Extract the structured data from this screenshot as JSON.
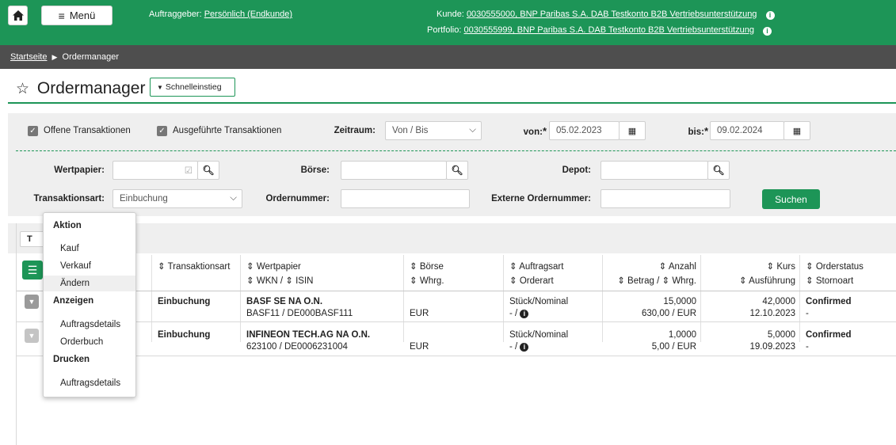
{
  "header": {
    "menu_label": "Menü",
    "client_prefix": "Auftraggeber:",
    "client_value": "Persönlich (Endkunde)",
    "customer_prefix": "Kunde:",
    "customer_value": "0030555000, BNP Paribas S.A. DAB Testkonto B2B Vertriebsunterstützung",
    "portfolio_prefix": "Portfolio:",
    "portfolio_value": "0030555999, BNP Paribas S.A. DAB Testkonto B2B Vertriebsunterstützung",
    "info_glyph": "i"
  },
  "breadcrumb": {
    "home": "Startseite",
    "current": "Ordermanager"
  },
  "page": {
    "title": "Ordermanager",
    "quick_entry": "Schnelleinstieg"
  },
  "filters": {
    "open_tx": "Offene Transaktionen",
    "executed_tx": "Ausgeführte Transaktionen",
    "period_label": "Zeitraum:",
    "period_value": "Von / Bis",
    "from_label": "von:",
    "from_value": "05.02.2023",
    "to_label": "bis:",
    "to_value": "09.02.2024",
    "required_mark": "*",
    "security_label": "Wertpapier:",
    "security_value": "",
    "exchange_label": "Börse:",
    "exchange_value": "",
    "depot_label": "Depot:",
    "depot_value": "",
    "tx_type_label": "Transaktionsart:",
    "tx_type_value": "Einbuchung",
    "order_no_label": "Ordernummer:",
    "order_no_value": "",
    "ext_order_no_label": "Externe Ordernummer:",
    "ext_order_no_value": "",
    "search_button": "Suchen",
    "filter_button": "T"
  },
  "table": {
    "headers": {
      "tx_type": "Transaktionsart",
      "security": "Wertpapier",
      "wkn_isin": "WKN / ⇕ ISIN",
      "exchange": "Börse",
      "currency": "Whrg.",
      "order_type": "Auftragsart",
      "order_kind": "Orderart",
      "quantity": "Anzahl",
      "amount_currency": "Betrag / ⇕ Whrg.",
      "price": "Kurs",
      "execution": "Ausführung",
      "order_status": "Orderstatus",
      "cancel_type": "Stornoart"
    },
    "rows": [
      {
        "tx_type": "Einbuchung",
        "security": "BASF SE NA O.N.",
        "wkn_isin": "BASF11 / DE000BASF111",
        "currency": "EUR",
        "order_type": "Stück/Nominal",
        "order_kind": "- /",
        "quantity": "15,0000",
        "amount": "630,00 / EUR",
        "price": "42,0000",
        "execution": "12.10.2023",
        "order_status": "Confirmed",
        "cancel_type": "-"
      },
      {
        "tx_type": "Einbuchung",
        "security": "INFINEON TECH.AG NA O.N.",
        "wkn_isin": "623100 / DE0006231004",
        "currency": "EUR",
        "order_type": "Stück/Nominal",
        "order_kind": "- /",
        "quantity": "1,0000",
        "amount": "5,00 / EUR",
        "price": "5,0000",
        "execution": "19.09.2023",
        "order_status": "Confirmed",
        "cancel_type": "-"
      }
    ]
  },
  "context_menu": {
    "group_action": "Aktion",
    "buy": "Kauf",
    "sell": "Verkauf",
    "change": "Ändern",
    "group_show": "Anzeigen",
    "order_details": "Auftragsdetails",
    "order_book": "Orderbuch",
    "group_print": "Drucken",
    "print_order_details": "Auftragsdetails"
  },
  "colors": {
    "brand_green": "#1d9557",
    "breadcrumb_bar": "#4e4e4e",
    "panel_gray": "#efefef"
  }
}
